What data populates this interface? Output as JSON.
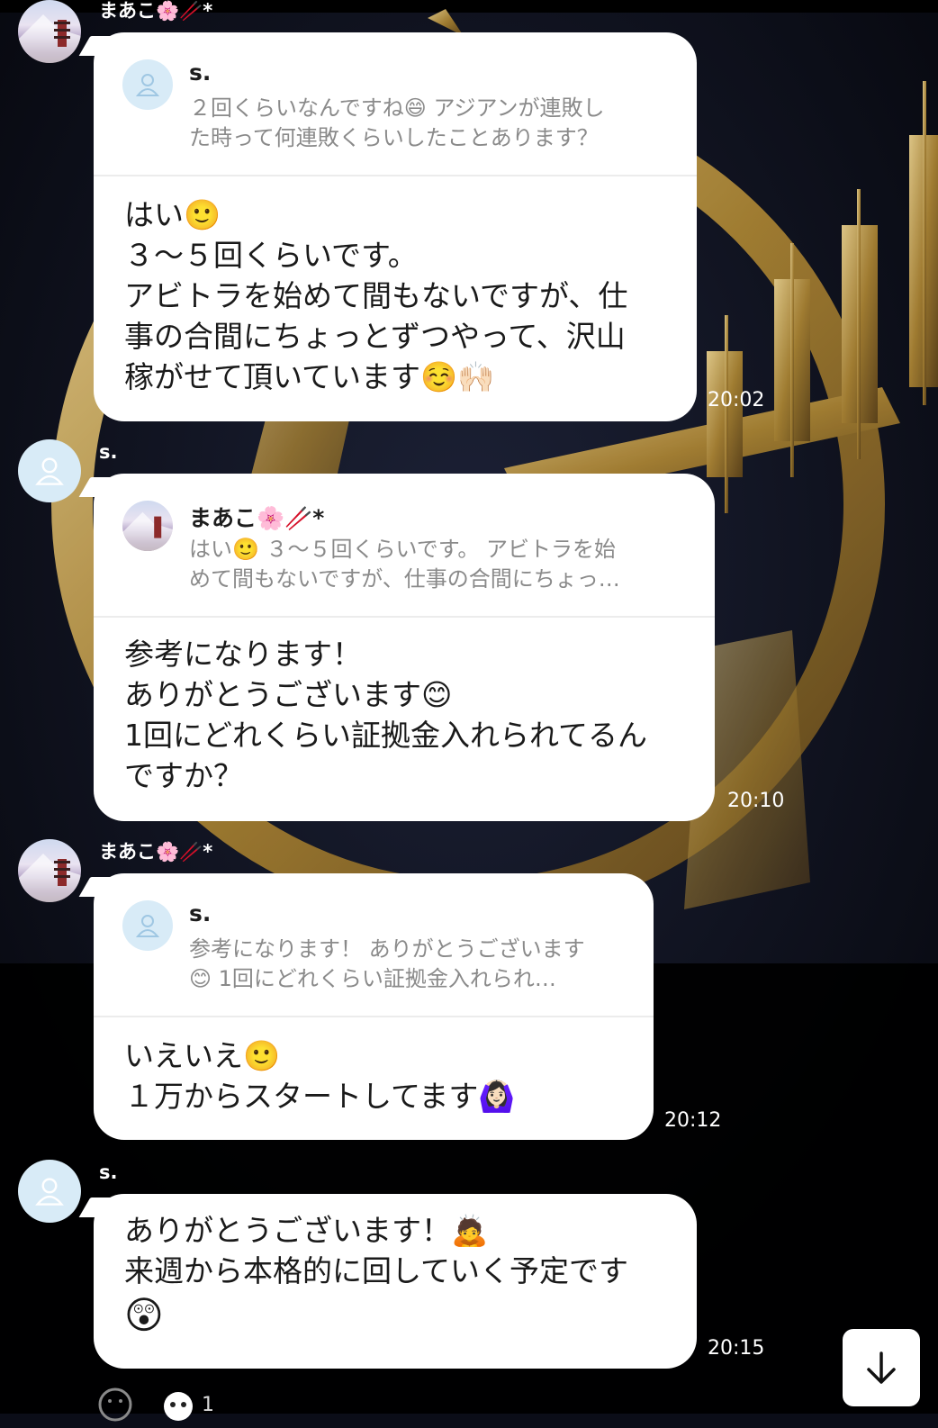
{
  "colors": {
    "background": "#0b0d18",
    "gold": "#b38e4a",
    "bubble": "#ffffff",
    "user_avatar": "#d8ebf7",
    "quote_text": "#8a8a8a"
  },
  "messages": [
    {
      "sender": "まあこ🌸🥢*",
      "quote": {
        "name": "s.",
        "line1": "２回くらいなんですね😄 アジアンが連敗し",
        "line2": "た時って何連敗くらいしたことあります？"
      },
      "lines": [
        "はい🙂",
        "３〜５回くらいです。",
        "アビトラを始めて間もないですが、仕",
        "事の合間にちょっとずつやって、沢山",
        "稼がせて頂いています☺️🙌🏻"
      ],
      "time": "20:02"
    },
    {
      "sender": "s.",
      "quote": {
        "name": "まあこ🌸🥢*",
        "line1": "はい🙂 ３〜５回くらいです。 アビトラを始",
        "line2": "めて間もないですが、仕事の合間にちょっ…"
      },
      "lines": [
        "参考になります！",
        "ありがとうございます😊",
        "1回にどれくらい証拠金入れられてるん",
        "ですか？"
      ],
      "time": "20:10"
    },
    {
      "sender": "まあこ🌸🥢*",
      "quote": {
        "name": "s.",
        "line1": "参考になります！ ありがとうございます",
        "line2": "😊 1回にどれくらい証拠金入れられ…"
      },
      "lines": [
        "いえいえ🙂",
        "１万からスタートしてます🙆🏻‍♀️"
      ],
      "time": "20:12"
    },
    {
      "sender": "s.",
      "lines": [
        "ありがとうございます！🙇",
        "来週から本格的に回していく予定です",
        "😲"
      ],
      "time": "20:15"
    }
  ],
  "reactions": {
    "add_reaction_icon": "smile-icon",
    "count": "1"
  },
  "scroll_button_icon": "arrow-down-icon"
}
